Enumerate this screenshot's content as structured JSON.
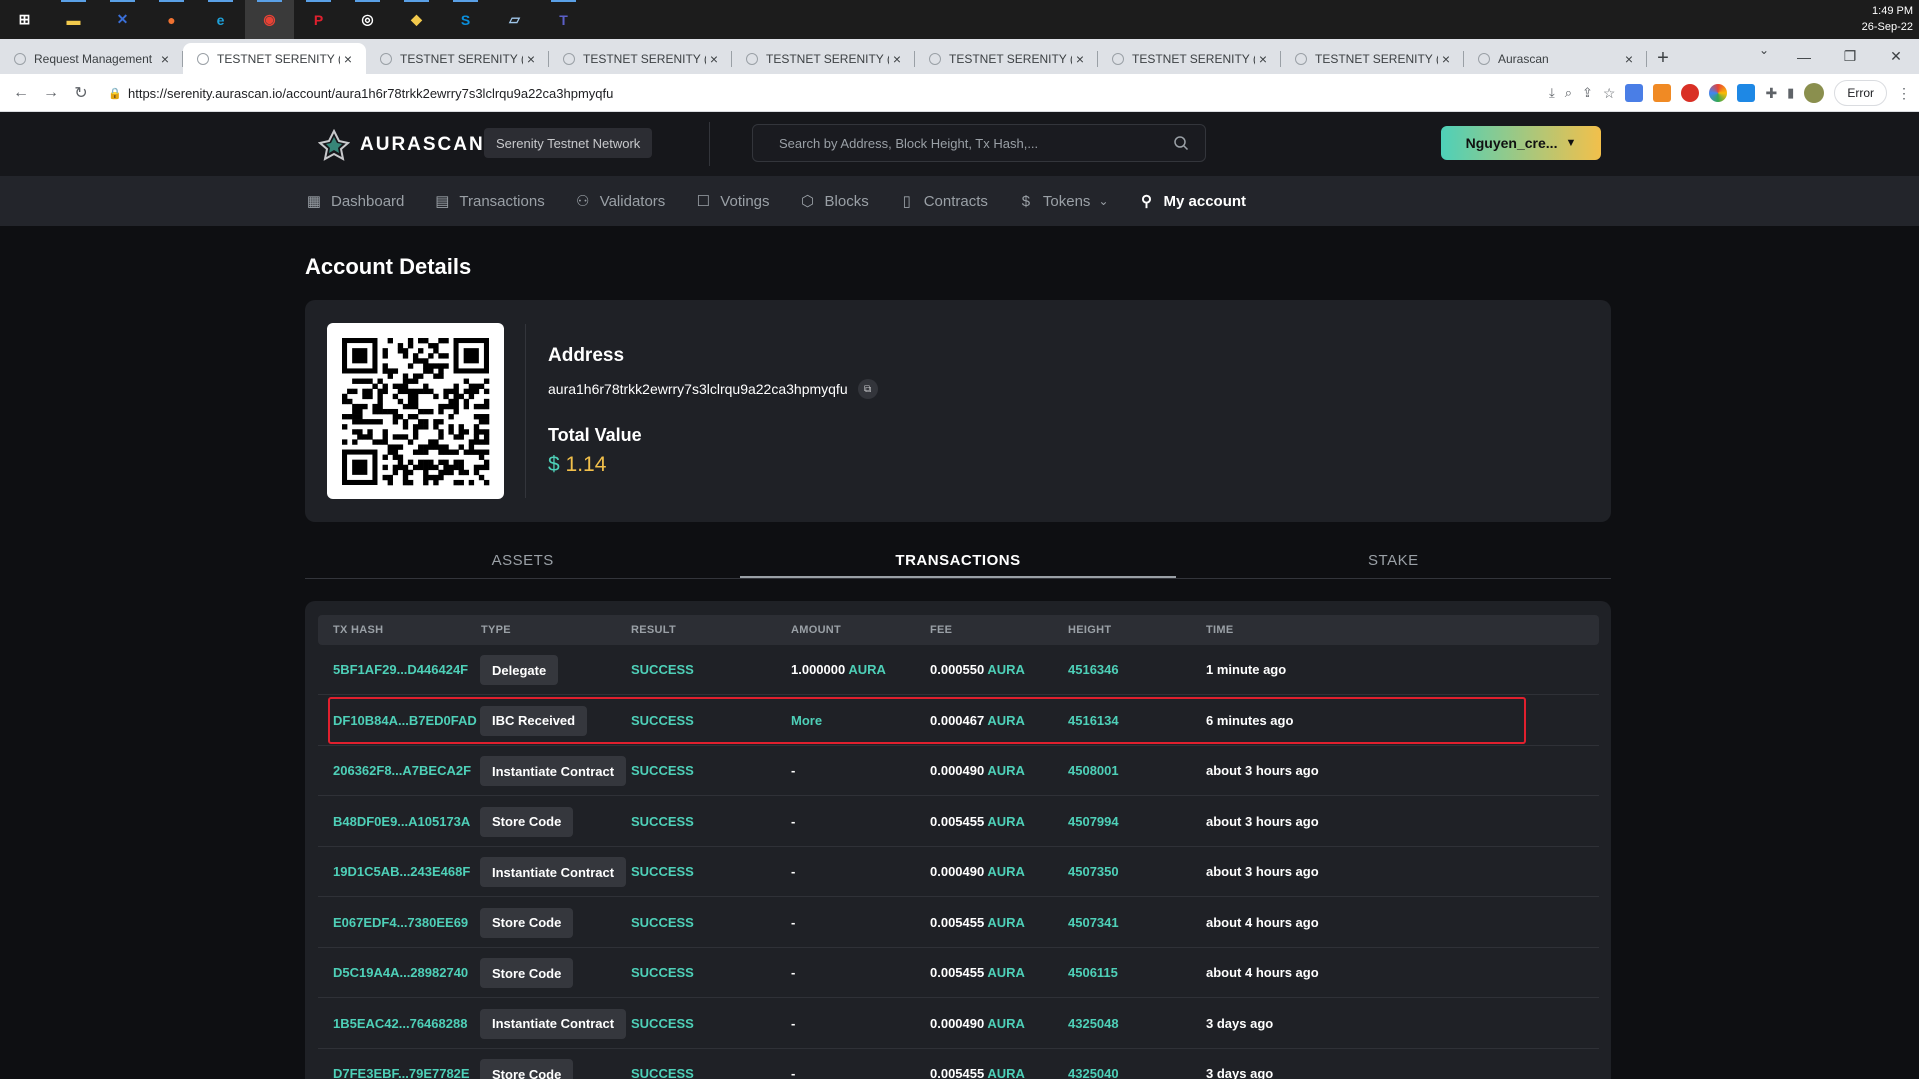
{
  "taskbar": {
    "apps": [
      {
        "name": "start-icon",
        "color": "#ffffff"
      },
      {
        "name": "file-explorer-icon",
        "color": "#f2c94c"
      },
      {
        "name": "tool-icon",
        "color": "#3a6fd8"
      },
      {
        "name": "postman-icon",
        "color": "#f07231"
      },
      {
        "name": "edge-icon",
        "color": "#1ea0d8"
      },
      {
        "name": "chrome-icon",
        "color": "#e94235"
      },
      {
        "name": "pocketcasts-icon",
        "color": "#e0202e"
      },
      {
        "name": "github-icon",
        "color": "#ffffff"
      },
      {
        "name": "git-icon",
        "color": "#f2c94c"
      },
      {
        "name": "skype-icon",
        "color": "#0a8fdc"
      },
      {
        "name": "notes-icon",
        "color": "#9fc5e8"
      },
      {
        "name": "teams-icon",
        "color": "#5b5fc7"
      }
    ],
    "clock_time": "1:49 PM",
    "clock_date": "26-Sep-22"
  },
  "browser": {
    "tabs": [
      {
        "title": "Request Management",
        "active": false
      },
      {
        "title": "TESTNET SERENITY (AU",
        "active": true
      },
      {
        "title": "TESTNET SERENITY (AU",
        "active": false
      },
      {
        "title": "TESTNET SERENITY (AU",
        "active": false
      },
      {
        "title": "TESTNET SERENITY (AU",
        "active": false
      },
      {
        "title": "TESTNET SERENITY (AU",
        "active": false
      },
      {
        "title": "TESTNET SERENITY (AU",
        "active": false
      },
      {
        "title": "TESTNET SERENITY (AU",
        "active": false
      },
      {
        "title": "Aurascan",
        "active": false
      }
    ],
    "url": "https://serenity.aurascan.io/account/aura1h6r78trkk2ewrry7s3lclrqu9a22ca3hpmyqfu",
    "error_label": "Error"
  },
  "site": {
    "logo_text": "AURASCAN",
    "network": "Serenity Testnet Network",
    "search_placeholder": "Search by Address, Block Height, Tx Hash,...",
    "wallet_label": "Nguyen_cre...",
    "nav": [
      {
        "label": "Dashboard",
        "icon": "dashboard-icon",
        "active": false
      },
      {
        "label": "Transactions",
        "icon": "transactions-icon",
        "active": false
      },
      {
        "label": "Validators",
        "icon": "validators-icon",
        "active": false
      },
      {
        "label": "Votings",
        "icon": "votings-icon",
        "active": false
      },
      {
        "label": "Blocks",
        "icon": "blocks-icon",
        "active": false
      },
      {
        "label": "Contracts",
        "icon": "contracts-icon",
        "active": false
      },
      {
        "label": "Tokens",
        "icon": "tokens-icon",
        "active": false
      },
      {
        "label": "My account",
        "icon": "user-icon",
        "active": true
      }
    ]
  },
  "account": {
    "page_title": "Account Details",
    "address_label": "Address",
    "address": "aura1h6r78trkk2ewrry7s3lclrqu9a22ca3hpmyqfu",
    "total_value_label": "Total Value",
    "total_value_currency": "$",
    "total_value": "1.14"
  },
  "tabs": [
    {
      "label": "ASSETS",
      "active": false
    },
    {
      "label": "TRANSACTIONS",
      "active": true
    },
    {
      "label": "STAKE",
      "active": false
    }
  ],
  "table": {
    "columns": [
      "TX HASH",
      "TYPE",
      "RESULT",
      "AMOUNT",
      "FEE",
      "HEIGHT",
      "TIME"
    ],
    "rows": [
      {
        "hash": "5BF1AF29...D446424F",
        "type": "Delegate",
        "result": "SUCCESS",
        "amount": "1.000000",
        "amount_unit": "AURA",
        "fee": "0.000550",
        "fee_unit": "AURA",
        "height": "4516346",
        "time": "1 minute ago"
      },
      {
        "hash": "DF10B84A...B7ED0FAD",
        "type": "IBC Received",
        "result": "SUCCESS",
        "amount": "More",
        "amount_unit": "",
        "fee": "0.000467",
        "fee_unit": "AURA",
        "height": "4516134",
        "time": "6 minutes ago"
      },
      {
        "hash": "206362F8...A7BECA2F",
        "type": "Instantiate Contract",
        "result": "SUCCESS",
        "amount": "-",
        "amount_unit": "",
        "fee": "0.000490",
        "fee_unit": "AURA",
        "height": "4508001",
        "time": "about 3 hours ago"
      },
      {
        "hash": "B48DF0E9...A105173A",
        "type": "Store Code",
        "result": "SUCCESS",
        "amount": "-",
        "amount_unit": "",
        "fee": "0.005455",
        "fee_unit": "AURA",
        "height": "4507994",
        "time": "about 3 hours ago"
      },
      {
        "hash": "19D1C5AB...243E468F",
        "type": "Instantiate Contract",
        "result": "SUCCESS",
        "amount": "-",
        "amount_unit": "",
        "fee": "0.000490",
        "fee_unit": "AURA",
        "height": "4507350",
        "time": "about 3 hours ago"
      },
      {
        "hash": "E067EDF4...7380EE69",
        "type": "Store Code",
        "result": "SUCCESS",
        "amount": "-",
        "amount_unit": "",
        "fee": "0.005455",
        "fee_unit": "AURA",
        "height": "4507341",
        "time": "about 4 hours ago"
      },
      {
        "hash": "D5C19A4A...28982740",
        "type": "Store Code",
        "result": "SUCCESS",
        "amount": "-",
        "amount_unit": "",
        "fee": "0.005455",
        "fee_unit": "AURA",
        "height": "4506115",
        "time": "about 4 hours ago"
      },
      {
        "hash": "1B5EAC42...76468288",
        "type": "Instantiate Contract",
        "result": "SUCCESS",
        "amount": "-",
        "amount_unit": "",
        "fee": "0.000490",
        "fee_unit": "AURA",
        "height": "4325048",
        "time": "3 days ago"
      },
      {
        "hash": "D7FE3EBF...79E7782E",
        "type": "Store Code",
        "result": "SUCCESS",
        "amount": "-",
        "amount_unit": "",
        "fee": "0.005455",
        "fee_unit": "AURA",
        "height": "4325040",
        "time": "3 days ago"
      }
    ]
  },
  "colors": {
    "accent_teal": "#4ed0b8",
    "accent_gold": "#f2c04b",
    "highlight_red": "#e0202e"
  }
}
